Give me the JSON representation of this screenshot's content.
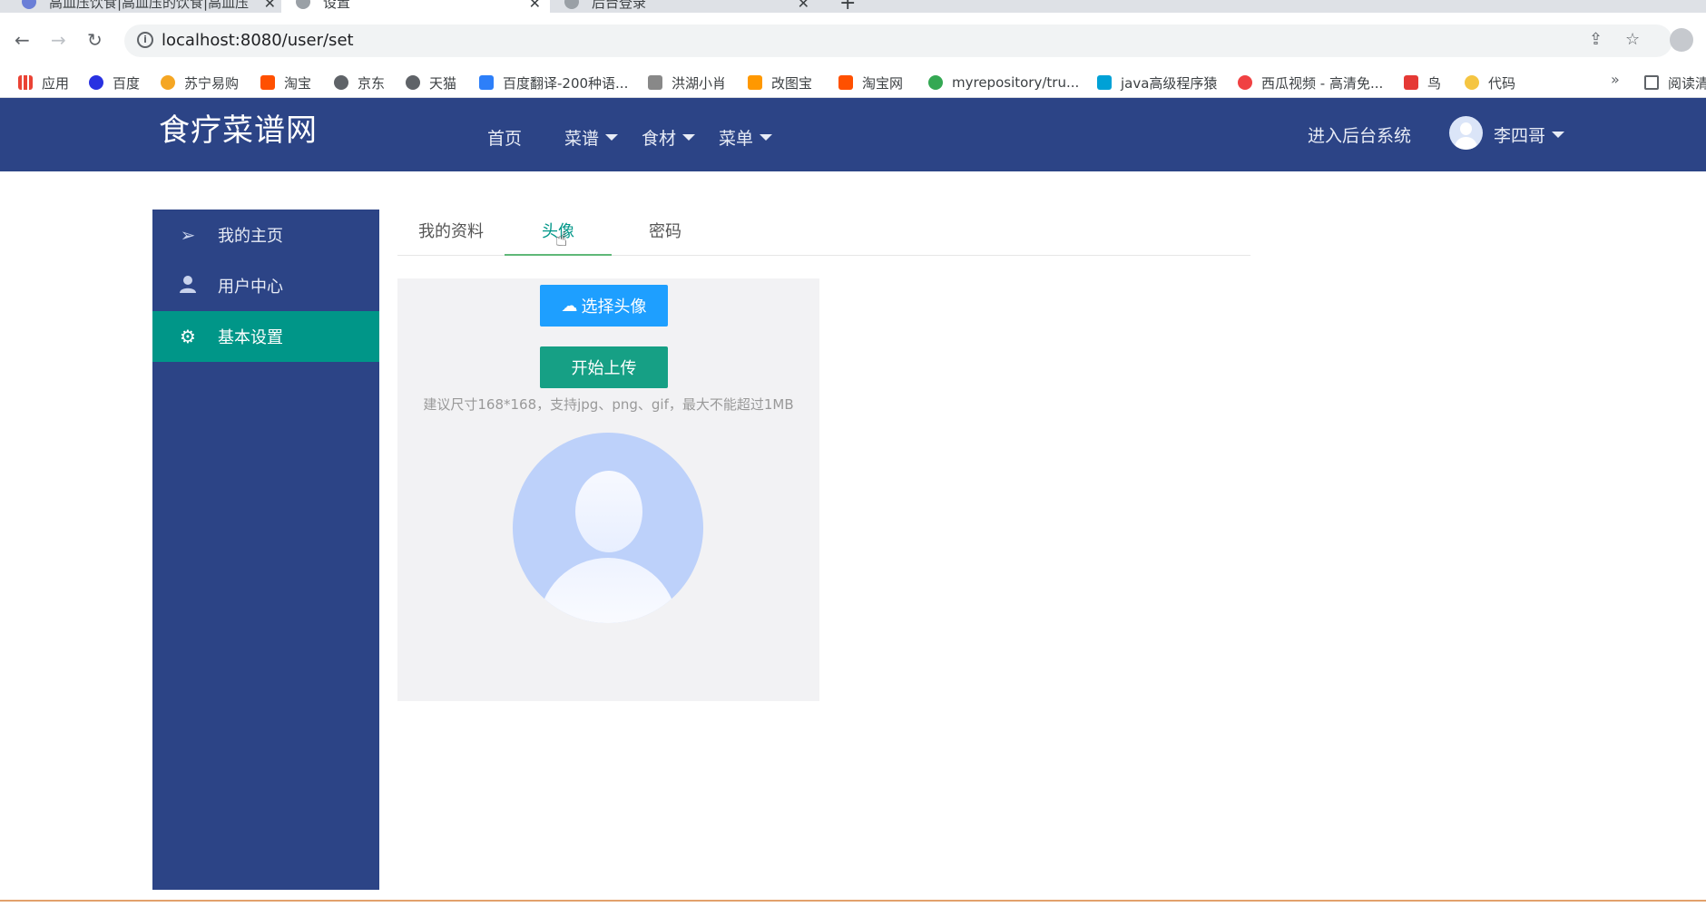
{
  "browser": {
    "tabs": [
      {
        "title": "高血压饮食|高血压的饮食|高血压"
      },
      {
        "title": "设置"
      },
      {
        "title": "后台登录"
      }
    ],
    "url": "localhost:8080/user/set",
    "bookmarks": [
      {
        "label": "应用",
        "icon": "apps-grid-icon",
        "color": "#ea4335"
      },
      {
        "label": "百度",
        "icon": "baidu-paw-icon",
        "color": "#2932e1"
      },
      {
        "label": "苏宁易购",
        "icon": "suning-lion-icon",
        "color": "#f5a623"
      },
      {
        "label": "淘宝",
        "icon": "taobao-icon",
        "color": "#ff5000"
      },
      {
        "label": "京东",
        "icon": "globe-icon",
        "color": "#5f6368"
      },
      {
        "label": "天猫",
        "icon": "globe-icon",
        "color": "#5f6368"
      },
      {
        "label": "百度翻译-200种语...",
        "icon": "translate-icon",
        "color": "#2d7ff9"
      },
      {
        "label": "洪湖小肖",
        "icon": "app-icon",
        "color": "#888888"
      },
      {
        "label": "改图宝",
        "icon": "app-icon",
        "color": "#ff9800"
      },
      {
        "label": "淘宝网",
        "icon": "taobao-icon",
        "color": "#ff5000"
      },
      {
        "label": "myrepository/tru...",
        "icon": "chrome-icon",
        "color": "#34a853"
      },
      {
        "label": "java高级程序猿",
        "icon": "bilibili-icon",
        "color": "#00a1d6"
      },
      {
        "label": "西瓜视频 - 高清免...",
        "icon": "xigua-icon",
        "color": "#f04142"
      },
      {
        "label": "鸟",
        "icon": "bird-icon",
        "color": "#e53935"
      },
      {
        "label": "代码",
        "icon": "app-icon",
        "color": "#f5c542"
      }
    ],
    "bookmarks_overflow": "»",
    "reading_list": "阅读清"
  },
  "site": {
    "logo": "食疗菜谱网",
    "nav": [
      {
        "label": "首页",
        "dropdown": false
      },
      {
        "label": "菜谱",
        "dropdown": true
      },
      {
        "label": "食材",
        "dropdown": true
      },
      {
        "label": "菜单",
        "dropdown": true
      }
    ],
    "backend_link": "进入后台系统",
    "user_name": "李四哥"
  },
  "sidebar": {
    "items": [
      {
        "label": "我的主页",
        "icon": "paper-plane-icon",
        "active": false
      },
      {
        "label": "用户中心",
        "icon": "user-icon",
        "active": false
      },
      {
        "label": "基本设置",
        "icon": "gear-icon",
        "active": true
      }
    ]
  },
  "tabs": [
    {
      "label": "我的资料",
      "active": false
    },
    {
      "label": "头像",
      "active": true
    },
    {
      "label": "密码",
      "active": false
    }
  ],
  "upload": {
    "choose_label": "选择头像",
    "upload_label": "开始上传",
    "hint": "建议尺寸168*168，支持jpg、png、gif，最大不能超过1MB"
  },
  "colors": {
    "header_bg": "#2c4486",
    "active_green": "#009688",
    "choose_btn": "#1e9fff",
    "upload_btn": "#16a085"
  }
}
